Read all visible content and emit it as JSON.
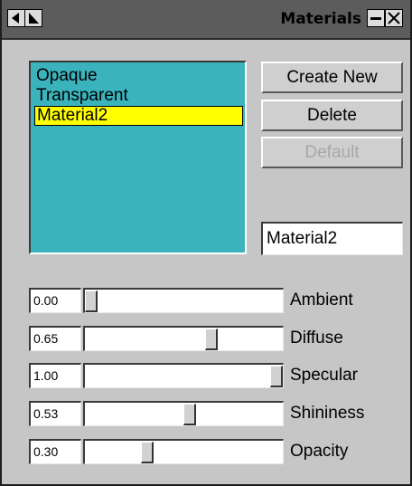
{
  "window": {
    "title": "Materials"
  },
  "titlebar_icons": {
    "left_1": "arrow-left-icon",
    "left_2": "arrow-down-right-icon",
    "minimize": "minimize-icon",
    "close": "close-icon"
  },
  "materials_list": {
    "items": [
      {
        "label": "Opaque",
        "selected": false
      },
      {
        "label": "Transparent",
        "selected": false
      },
      {
        "label": "Material2",
        "selected": true
      }
    ]
  },
  "buttons": {
    "create_new": "Create New",
    "delete": "Delete",
    "default": "Default"
  },
  "name_field": {
    "value": "Material2"
  },
  "properties": [
    {
      "label": "Ambient",
      "value_text": "0.00",
      "value": 0.0
    },
    {
      "label": "Diffuse",
      "value_text": "0.65",
      "value": 0.65
    },
    {
      "label": "Specular",
      "value_text": "1.00",
      "value": 1.0
    },
    {
      "label": "Shininess",
      "value_text": "0.53",
      "value": 0.53
    },
    {
      "label": "Opacity",
      "value_text": "0.30",
      "value": 0.3
    }
  ],
  "colors": {
    "list_background": "#3ab3bd",
    "selection_highlight": "#ffff00",
    "titlebar": "#5c5c5c",
    "panel": "#c6c6c6"
  }
}
